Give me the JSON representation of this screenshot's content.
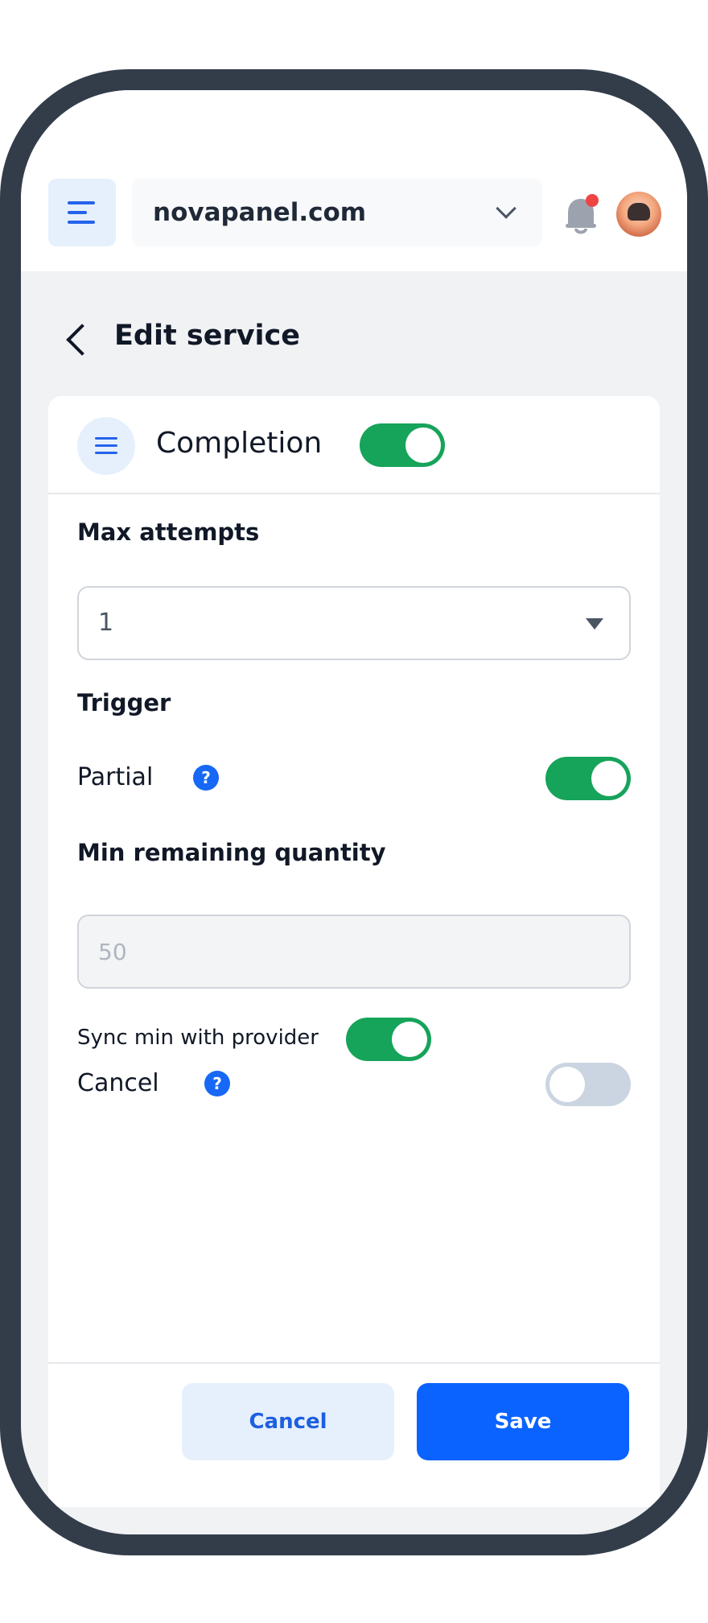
{
  "header": {
    "domain": "novapanel.com",
    "notification_dot_color": "#ef4444",
    "menu_icon": "hamburger-icon",
    "bell_icon": "bell-icon"
  },
  "page": {
    "title": "Edit service",
    "back_icon": "chevron-left-icon"
  },
  "card": {
    "icon": "list-icon",
    "title": "Completion",
    "enabled": true,
    "max_attempts": {
      "label": "Max attempts",
      "value": "1"
    },
    "trigger": {
      "label": "Trigger"
    },
    "partial": {
      "label": "Partial",
      "help": "?",
      "enabled": true
    },
    "min_remaining": {
      "label": "Min remaining quantity",
      "placeholder": "50"
    },
    "sync_min": {
      "label": "Sync min with provider",
      "enabled": true
    },
    "cancel_toggle": {
      "label": "Cancel",
      "help": "?",
      "enabled": false
    }
  },
  "footer": {
    "cancel_label": "Cancel",
    "save_label": "Save"
  },
  "colors": {
    "accent": "#0a62ff",
    "toggle_on": "#16a35a",
    "toggle_off": "#cbd5e1"
  }
}
